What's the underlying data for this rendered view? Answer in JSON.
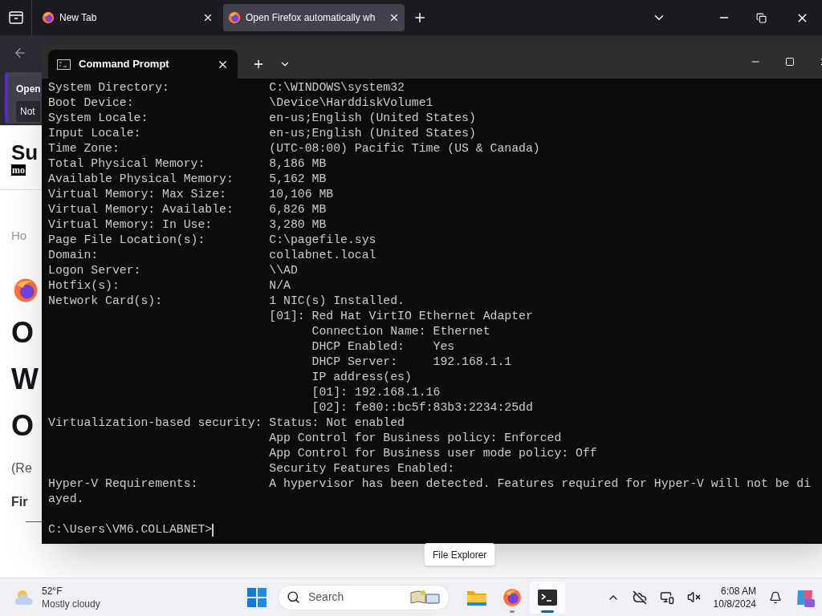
{
  "browser": {
    "tabs": [
      {
        "title": "New Tab",
        "selected": false
      },
      {
        "title": "Open Firefox automatically wh",
        "selected": true
      }
    ],
    "notification": {
      "title": "Open",
      "button": "Not"
    },
    "page": {
      "logo": "Su",
      "logo_tag": "mo",
      "breadcrumb": "Ho",
      "heading_lines": [
        "O",
        "W",
        "O"
      ],
      "subtitle": "(Re",
      "section": "Fir"
    }
  },
  "terminal": {
    "tab_title": "Command Prompt",
    "lines": [
      {
        "kind": "field",
        "label": "System Directory:",
        "value": "C:\\WINDOWS\\system32"
      },
      {
        "kind": "field",
        "label": "Boot Device:",
        "value": "\\Device\\HarddiskVolume1"
      },
      {
        "kind": "field",
        "label": "System Locale:",
        "value": "en-us;English (United States)"
      },
      {
        "kind": "field",
        "label": "Input Locale:",
        "value": "en-us;English (United States)"
      },
      {
        "kind": "field",
        "label": "Time Zone:",
        "value": "(UTC-08:00) Pacific Time (US & Canada)"
      },
      {
        "kind": "field",
        "label": "Total Physical Memory:",
        "value": "8,186 MB"
      },
      {
        "kind": "field",
        "label": "Available Physical Memory:",
        "value": "5,162 MB"
      },
      {
        "kind": "field",
        "label": "Virtual Memory: Max Size:",
        "value": "10,106 MB"
      },
      {
        "kind": "field",
        "label": "Virtual Memory: Available:",
        "value": "6,826 MB"
      },
      {
        "kind": "field",
        "label": "Virtual Memory: In Use:",
        "value": "3,280 MB"
      },
      {
        "kind": "field",
        "label": "Page File Location(s):",
        "value": "C:\\pagefile.sys"
      },
      {
        "kind": "field",
        "label": "Domain:",
        "value": "collabnet.local"
      },
      {
        "kind": "field",
        "label": "Logon Server:",
        "value": "\\\\AD"
      },
      {
        "kind": "field",
        "label": "Hotfix(s):",
        "value": "N/A"
      },
      {
        "kind": "field",
        "label": "Network Card(s):",
        "value": "1 NIC(s) Installed."
      },
      {
        "kind": "continued",
        "value": "[01]: Red Hat VirtIO Ethernet Adapter"
      },
      {
        "kind": "continued",
        "value": "      Connection Name: Ethernet"
      },
      {
        "kind": "continued",
        "value": "      DHCP Enabled:    Yes"
      },
      {
        "kind": "continued",
        "value": "      DHCP Server:     192.168.1.1"
      },
      {
        "kind": "continued",
        "value": "      IP address(es)"
      },
      {
        "kind": "continued",
        "value": "      [01]: 192.168.1.16"
      },
      {
        "kind": "continued",
        "value": "      [02]: fe80::bc5f:83b3:2234:25dd"
      },
      {
        "kind": "field",
        "label": "Virtualization-based security:",
        "value": "Status: Not enabled"
      },
      {
        "kind": "continued",
        "value": "App Control for Business policy: Enforced"
      },
      {
        "kind": "continued",
        "value": "App Control for Business user mode policy: Off"
      },
      {
        "kind": "continued",
        "value": "Security Features Enabled:"
      },
      {
        "kind": "field",
        "label": "Hyper-V Requirements:",
        "value": "A hypervisor has been detected. Features required for Hyper-V will not be di"
      },
      {
        "kind": "wrapped",
        "value": "ayed."
      },
      {
        "kind": "blank"
      },
      {
        "kind": "prompt",
        "value": "C:\\Users\\VM6.COLLABNET>"
      }
    ]
  },
  "tooltip": "File Explorer",
  "taskbar": {
    "weather": {
      "temperature": "52°F",
      "condition": "Mostly cloudy"
    },
    "search": {
      "placeholder": "Search"
    },
    "apps": [
      {
        "kind": "explorer",
        "running": false,
        "selected": false
      },
      {
        "kind": "firefox",
        "running": true,
        "selected": false
      },
      {
        "kind": "terminal",
        "running": true,
        "selected": true
      }
    ],
    "time": "6:08 AM",
    "date": "10/8/2024"
  }
}
